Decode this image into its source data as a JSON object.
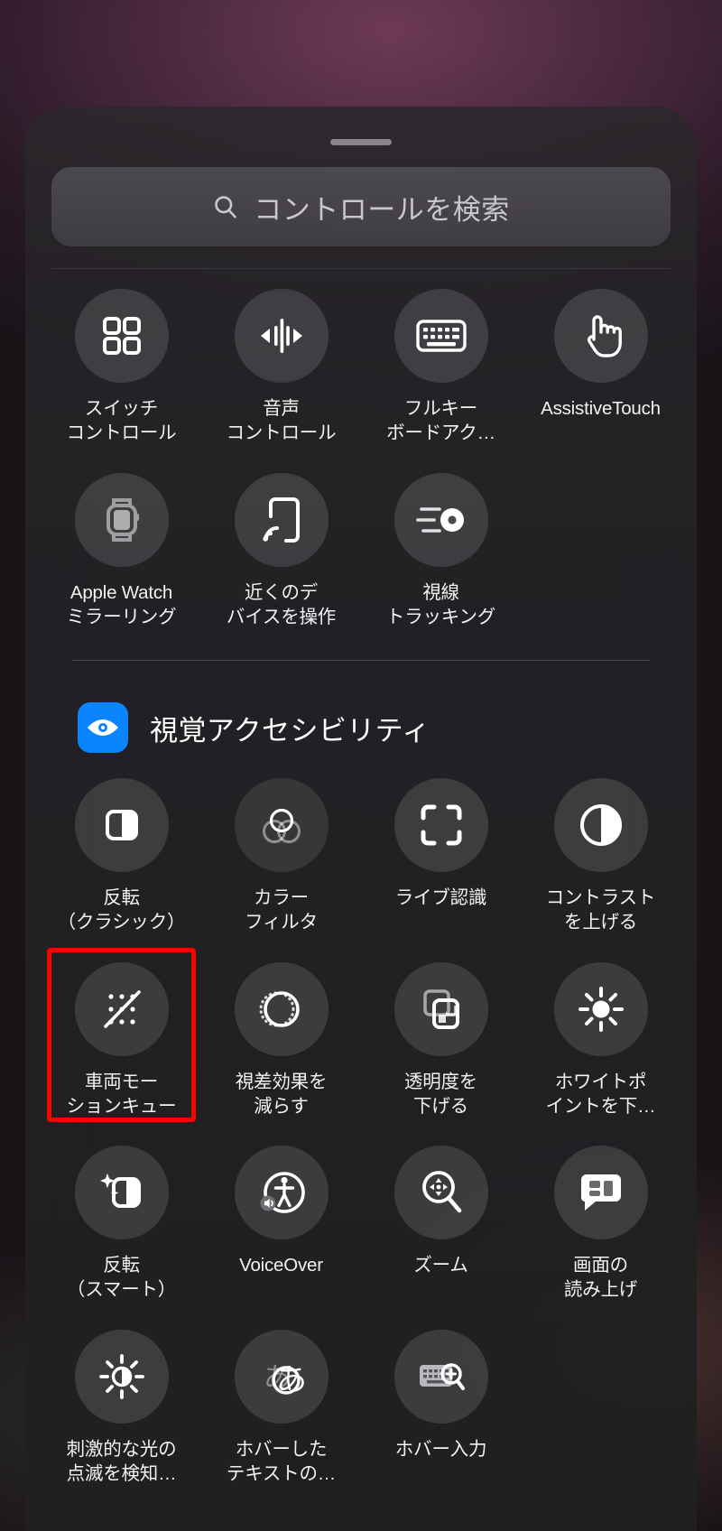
{
  "search": {
    "placeholder": "コントロールを検索",
    "icon": "search-icon"
  },
  "grabber": {
    "name": "sheet-grab-handle"
  },
  "accessibility_controls": [
    {
      "label": "スイッチ\nコントロール",
      "icon": "switch-control-grid-icon",
      "latin": false
    },
    {
      "label": "音声\nコントロール",
      "icon": "voice-control-waveform-icon",
      "latin": false
    },
    {
      "label": "フルキー\nボードアク…",
      "icon": "keyboard-icon",
      "latin": false
    },
    {
      "label": "AssistiveTouch",
      "icon": "pointing-hand-icon",
      "latin": true
    },
    {
      "label": "Apple Watch\nミラーリング",
      "icon": "apple-watch-icon",
      "latin": false
    },
    {
      "label": "近くのデ\nバイスを操作",
      "icon": "nearby-device-control-icon",
      "latin": false
    },
    {
      "label": "視線\nトラッキング",
      "icon": "eye-tracking-icon",
      "latin": false
    }
  ],
  "vision_section": {
    "title": "視覚アクセシビリティ",
    "icon": "eye-icon",
    "icon_color": "#0a84ff"
  },
  "vision_controls": [
    {
      "label": "反転\n（クラシック）",
      "icon": "invert-classic-icon",
      "highlighted": false
    },
    {
      "label": "カラー\nフィルタ",
      "icon": "color-filters-icon",
      "highlighted": false
    },
    {
      "label": "ライブ認識",
      "icon": "live-recognition-brackets-icon",
      "highlighted": false
    },
    {
      "label": "コントラスト\nを上げる",
      "icon": "increase-contrast-icon",
      "highlighted": false
    },
    {
      "label": "車両モー\nションキュー",
      "icon": "vehicle-motion-cues-icon",
      "highlighted": true
    },
    {
      "label": "視差効果を\n減らす",
      "icon": "reduce-motion-icon",
      "highlighted": false
    },
    {
      "label": "透明度を\n下げる",
      "icon": "reduce-transparency-icon",
      "highlighted": false
    },
    {
      "label": "ホワイトポ\nイントを下…",
      "icon": "reduce-white-point-sun-icon",
      "highlighted": false
    },
    {
      "label": "反転\n（スマート）",
      "icon": "smart-invert-icon",
      "highlighted": false
    },
    {
      "label": "VoiceOver",
      "icon": "voiceover-icon",
      "highlighted": false
    },
    {
      "label": "ズーム",
      "icon": "zoom-magnifier-icon",
      "highlighted": false
    },
    {
      "label": "画面の\n読み上げ",
      "icon": "speak-screen-icon",
      "highlighted": false
    },
    {
      "label": "刺激的な光の\n点滅を検知…",
      "icon": "flashing-lights-icon",
      "highlighted": false
    },
    {
      "label": "ホバーした\nテキストの…",
      "icon": "hover-text-icon",
      "highlighted": false
    },
    {
      "label": "ホバー入力",
      "icon": "hover-typing-icon",
      "highlighted": false
    }
  ],
  "highlight": {
    "color": "#ff0000"
  }
}
